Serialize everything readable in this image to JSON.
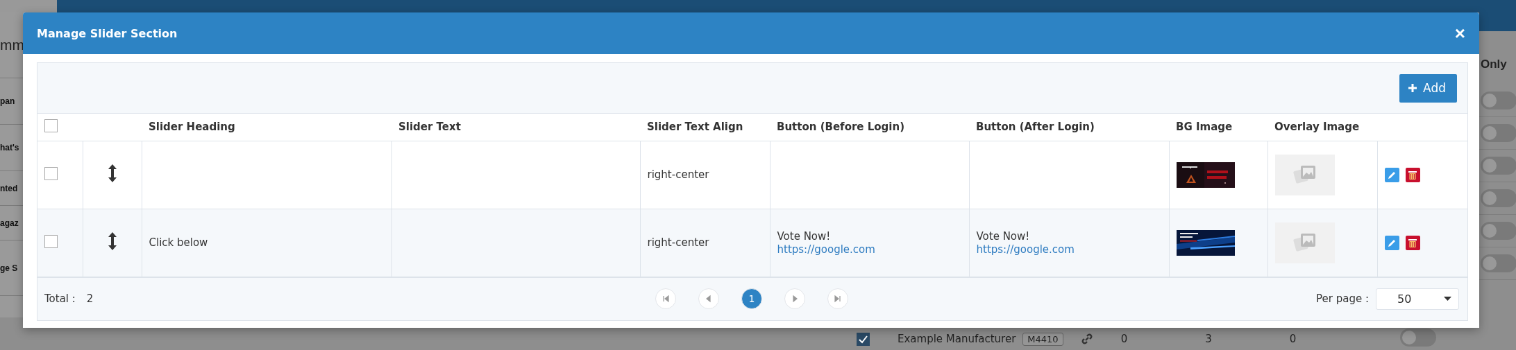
{
  "background": {
    "heading": "mm",
    "left_items": [
      {
        "label": "pan"
      },
      {
        "label": "hat's"
      },
      {
        "label": "nted"
      },
      {
        "label": "agaz"
      },
      {
        "label": "ge S"
      }
    ],
    "right_heading": "Only",
    "toggles": [
      {
        "on": false
      },
      {
        "on": false
      },
      {
        "on": false
      },
      {
        "on": false
      },
      {
        "on": false
      },
      {
        "on": false
      }
    ],
    "bottom_row": {
      "checked": true,
      "name": "Example Manufacturer",
      "code": "M4410",
      "values": [
        "0",
        "3",
        "0"
      ],
      "toggle": {
        "on": false
      }
    }
  },
  "modal": {
    "title": "Manage Slider Section",
    "close": "×",
    "add_button": "Add",
    "select_all": {
      "checked": false
    },
    "columns": [
      "Slider Heading",
      "Slider Text",
      "Slider Text Align",
      "Button (Before Login)",
      "Button (After Login)",
      "BG Image",
      "Overlay Image"
    ],
    "rows": [
      {
        "checked": false,
        "align": "right-center"
      },
      {
        "checked": false,
        "heading": "Click below",
        "align": "right-center",
        "before_login": {
          "label": "Vote Now!",
          "url": "https://google.com"
        },
        "after_login": {
          "label": "Vote Now!",
          "url": "https://google.com"
        }
      }
    ],
    "footer": {
      "total_label": "Total :",
      "total": "2",
      "pages": [
        {
          "label": "1",
          "selected": true
        }
      ],
      "per_page_label": "Per page :",
      "per_page": "50"
    }
  }
}
